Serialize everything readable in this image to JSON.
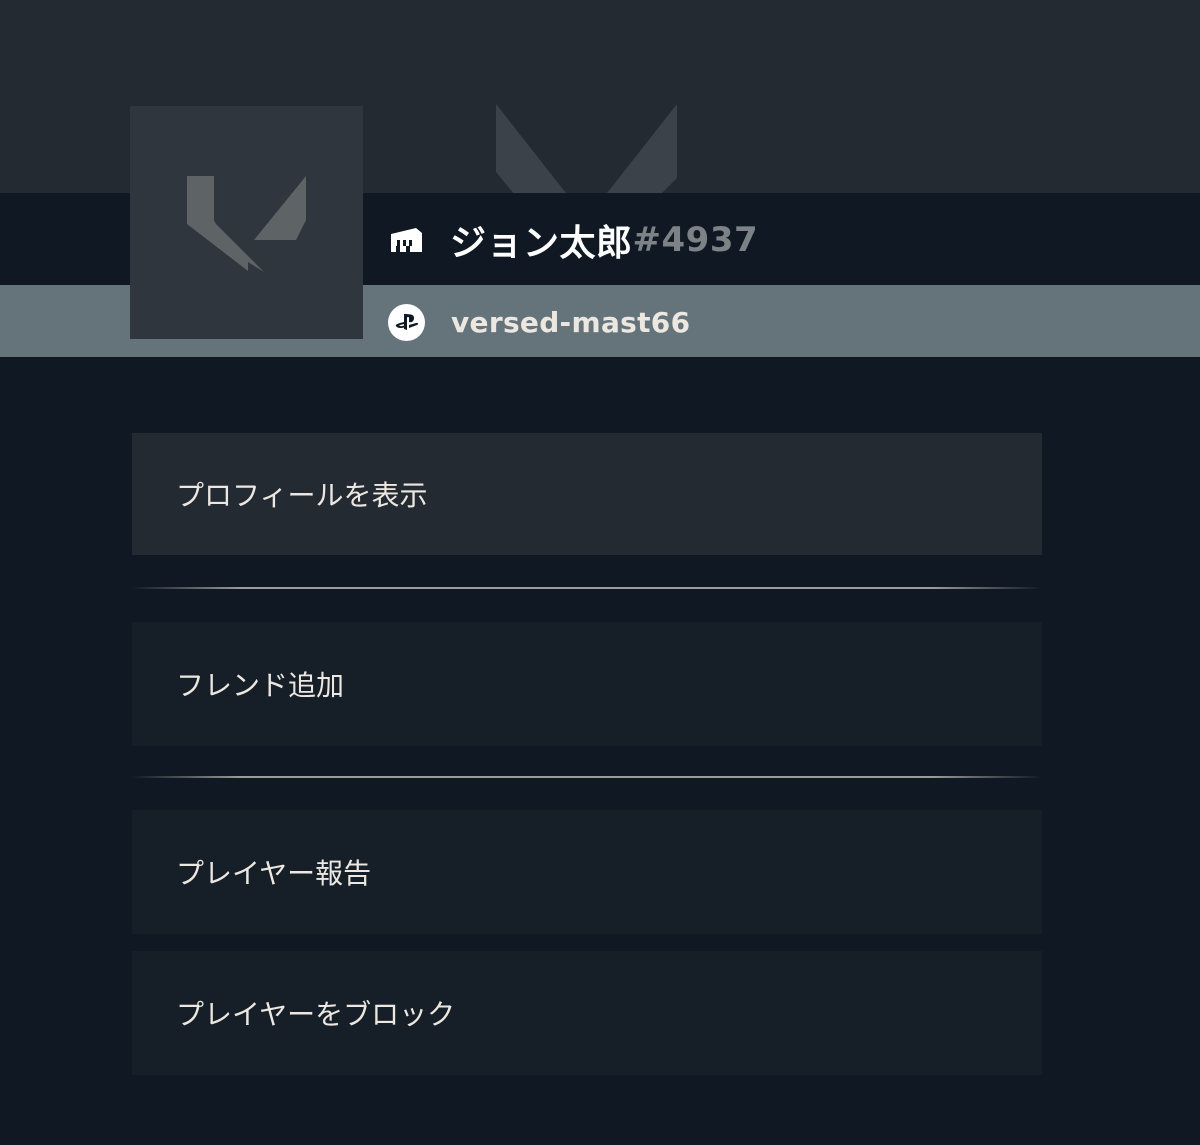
{
  "player": {
    "name": "ジョン太郎",
    "tag": "#4937",
    "platform_account": "versed-mast66"
  },
  "icons": {
    "avatar": "valorant-logo",
    "banner": "valorant-logo",
    "account": "riot-fist-icon",
    "platform": "playstation-icon"
  },
  "menu": {
    "items": [
      {
        "label": "プロフィールを表示"
      },
      {
        "label": "フレンド追加"
      },
      {
        "label": "プレイヤー報告"
      },
      {
        "label": "プレイヤーをブロック"
      }
    ]
  },
  "colors": {
    "background": "#101923",
    "banner": "#232a32",
    "platform_band": "#65737b",
    "menu_item": "#161e27",
    "menu_item_active": "#232a32",
    "tag": "#7d8287"
  }
}
